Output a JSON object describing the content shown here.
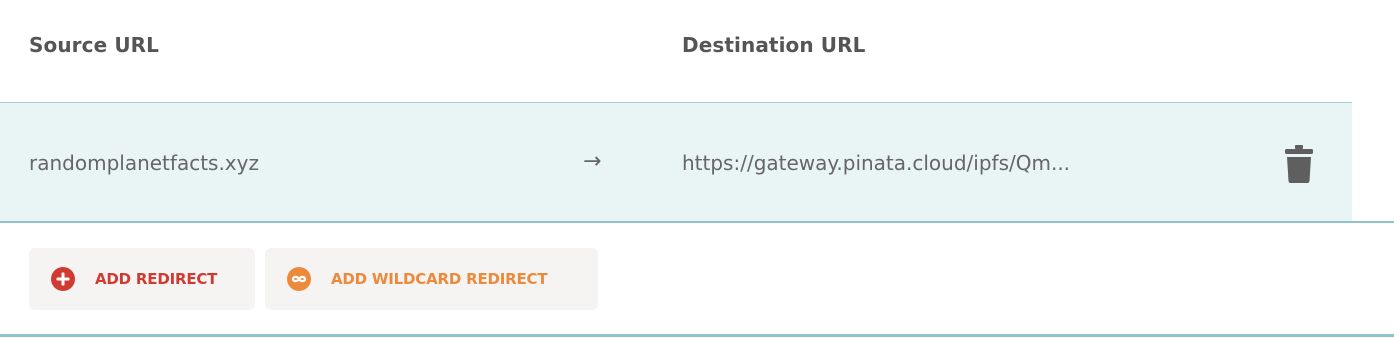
{
  "table": {
    "headers": {
      "source": "Source URL",
      "destination": "Destination URL"
    },
    "rows": [
      {
        "source": "randomplanetfacts.xyz",
        "arrow": "→",
        "destination": "https://gateway.pinata.cloud/ipfs/Qm...",
        "delete_icon": "trash-icon"
      }
    ]
  },
  "actions": {
    "add_redirect": {
      "label": "ADD REDIRECT",
      "icon": "plus-circle-icon",
      "color": "#cf3b33"
    },
    "add_wildcard_redirect": {
      "label": "ADD WILDCARD REDIRECT",
      "icon": "infinity-circle-icon",
      "color": "#ec8a3c"
    }
  },
  "colors": {
    "row_background": "#e9f4f5",
    "divider": "#8fc4ca",
    "header_text": "#555555",
    "cell_text": "#666666",
    "button_background": "#f6f4f3"
  }
}
